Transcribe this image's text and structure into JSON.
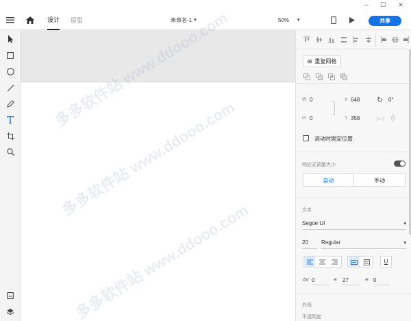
{
  "window": {
    "minimize": "─",
    "maximize": "☐",
    "close": "✕"
  },
  "toolbar": {
    "tabs": [
      {
        "label": "设计"
      },
      {
        "label": "原型"
      }
    ],
    "document_title": "未命名-1",
    "zoom": "50%",
    "share_label": "共享"
  },
  "panel": {
    "repeat_grid_label": "重复网格",
    "transform": {
      "w_label": "W",
      "w_value": "0",
      "h_label": "H",
      "h_value": "0",
      "x_label": "X",
      "x_value": "648",
      "y_label": "Y",
      "y_value": "358",
      "rotation": "0°"
    },
    "fix_position_label": "滚动时固定位置",
    "responsive_label": "响应式调整大小",
    "responsive_auto": "自动",
    "responsive_manual": "手动",
    "text_section_label": "文本",
    "font_family": "Segoe UI",
    "font_size": "20",
    "font_weight": "Regular",
    "char_spacing": "0",
    "line_spacing": "27",
    "para_spacing": "0",
    "underline_label": "U",
    "appearance_label": "外观",
    "appearance_sub": "不透明度"
  },
  "canvas": {
    "watermark": "多多软件站 www.ddooo.com"
  },
  "colors": {
    "accent": "#1473e6",
    "toggle": "#555555",
    "active_text": "#1473e6"
  }
}
